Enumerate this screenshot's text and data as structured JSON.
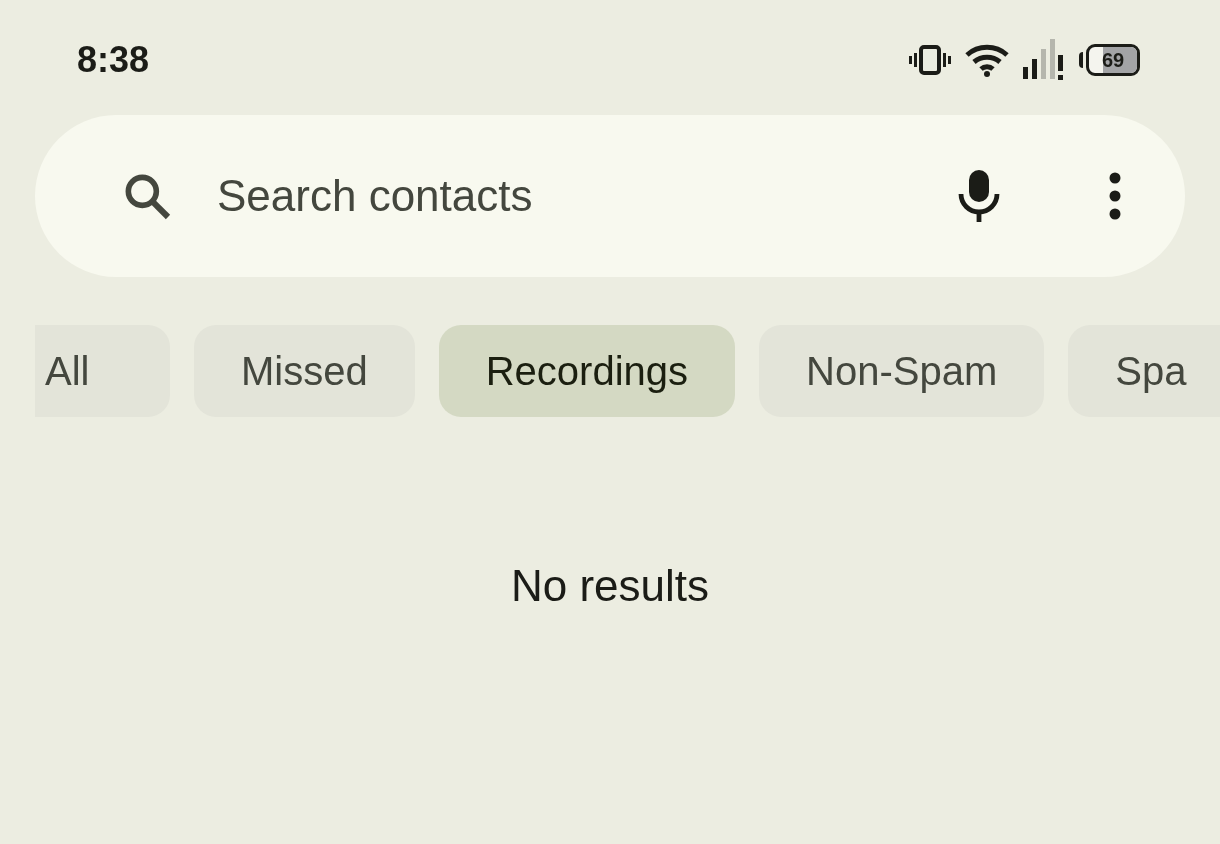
{
  "status_bar": {
    "time": "8:38",
    "battery": "69"
  },
  "search": {
    "placeholder": "Search contacts"
  },
  "filters": [
    {
      "label": "All",
      "selected": false
    },
    {
      "label": "Missed",
      "selected": false
    },
    {
      "label": "Recordings",
      "selected": true
    },
    {
      "label": "Non-Spam",
      "selected": false
    },
    {
      "label": "Spa",
      "selected": false
    }
  ],
  "empty_message": "No results"
}
